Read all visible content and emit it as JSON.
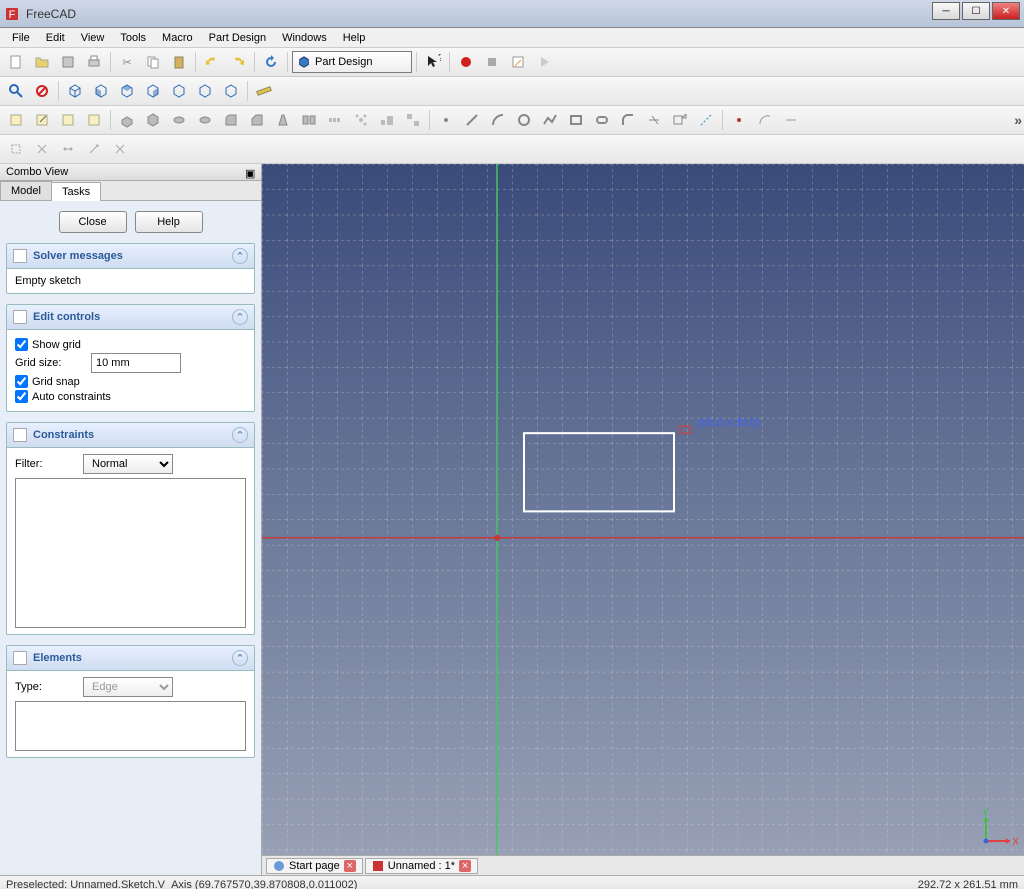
{
  "window": {
    "title": "FreeCAD"
  },
  "menu": {
    "items": [
      "File",
      "Edit",
      "View",
      "Tools",
      "Macro",
      "Part Design",
      "Windows",
      "Help"
    ]
  },
  "toolbar": {
    "workbench": "Part Design",
    "record_icon": "record-icon",
    "stop_icon": "stop-icon"
  },
  "combo": {
    "title": "Combo View",
    "tabs": {
      "model": "Model",
      "tasks": "Tasks"
    },
    "close": "Close",
    "help": "Help"
  },
  "solver": {
    "title": "Solver messages",
    "msg": "Empty sketch"
  },
  "edit": {
    "title": "Edit controls",
    "show_grid": "Show grid",
    "grid_size_label": "Grid size:",
    "grid_size_value": "10 mm",
    "grid_snap": "Grid snap",
    "auto_constraints": "Auto constraints"
  },
  "constraints": {
    "title": "Constraints",
    "filter_label": "Filter:",
    "filter_value": "Normal"
  },
  "elements": {
    "title": "Elements",
    "type_label": "Type:",
    "type_value": "Edge"
  },
  "viewport": {
    "rect_label": "(60.0 x 30.0)",
    "tabs": {
      "start": "Start page",
      "doc": "Unnamed : 1*"
    }
  },
  "status": {
    "left": "Preselected: Unnamed.Sketch.V_Axis (69.767570,39.870808,0.011002)",
    "right": "292.72 x 261.51 mm"
  },
  "axis": {
    "x": "X",
    "y": "Y"
  }
}
